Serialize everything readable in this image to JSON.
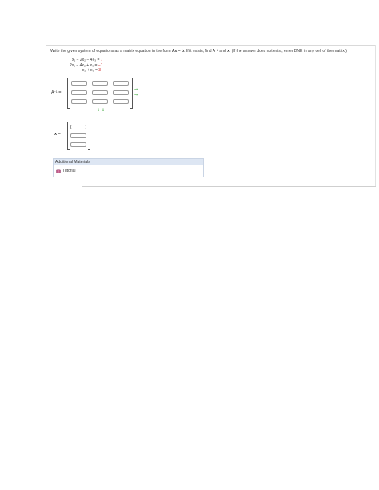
{
  "prompt": {
    "part1": "Write the given system of equations as a matrix equation in the form ",
    "ax": "Ax",
    "eq": " = ",
    "b": "b",
    "part2": ". If it exists, find ",
    "ainv_base": "A",
    "ainv_exp": "−1",
    "part3": " and ",
    "x": "x",
    "part4": ". (If the answer does not exist, enter DNE in any cell of the matrix.)"
  },
  "equations": [
    {
      "lhs": "x₁ − 2x₂ − 4x₃ =",
      "rhs": "7"
    },
    {
      "lhs": "2x₁ − 4x₂ + x₃ =",
      "rhs": "−1"
    },
    {
      "lhs": "−x₂ + x₃ =",
      "rhs": "3"
    }
  ],
  "ainv_label": {
    "base": "A",
    "exp": "−1",
    "eq": " ="
  },
  "x_label": {
    "name": "x",
    "eq": " ="
  },
  "additional": {
    "header": "Additional Materials",
    "tutorial": "Tutorial"
  },
  "colors": {
    "rhs": "#cc2222",
    "accent_green": "#3aa53a",
    "materials_header_bg": "#dde6f3"
  },
  "icons": [
    "arrow-right-icon",
    "arrow-down-icon",
    "book-icon"
  ]
}
